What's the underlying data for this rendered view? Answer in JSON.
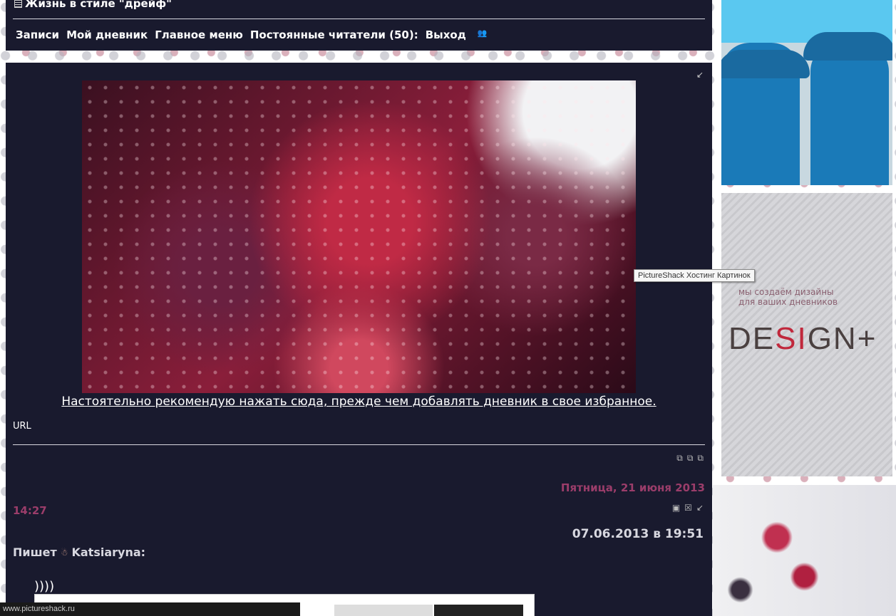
{
  "header": {
    "title": "Жизнь в стиле \"дрейф\"",
    "nav": [
      "Записи",
      "Мой дневник",
      "Главное меню",
      "Постоянные читатели (50):",
      "Выход"
    ]
  },
  "post": {
    "recommend_link": "Настоятельно рекомендую нажать сюда, прежде чем добавлять дневник в свое избранное.",
    "url_label": "URL",
    "date": "Пятница, 21 июня 2013",
    "time": "14:27",
    "quote_date": "07.06.2013 в 19:51",
    "author_prefix": "Пишет",
    "author_name": "Katsiaryna:",
    "quote_text": "))))"
  },
  "sidebar": {
    "banner2_tagline_1": "мы создаём дизайны",
    "banner2_tagline_2": "для ваших дневников",
    "banner2_logo_a": "DE",
    "banner2_logo_b": "SI",
    "banner2_logo_c": "GN"
  },
  "tooltip": "PictureShack Хостинг Картинок",
  "statusbar": "www.pictureshack.ru",
  "colors": {
    "panel": "#191a2e",
    "date_accent": "#9b3d6a"
  }
}
